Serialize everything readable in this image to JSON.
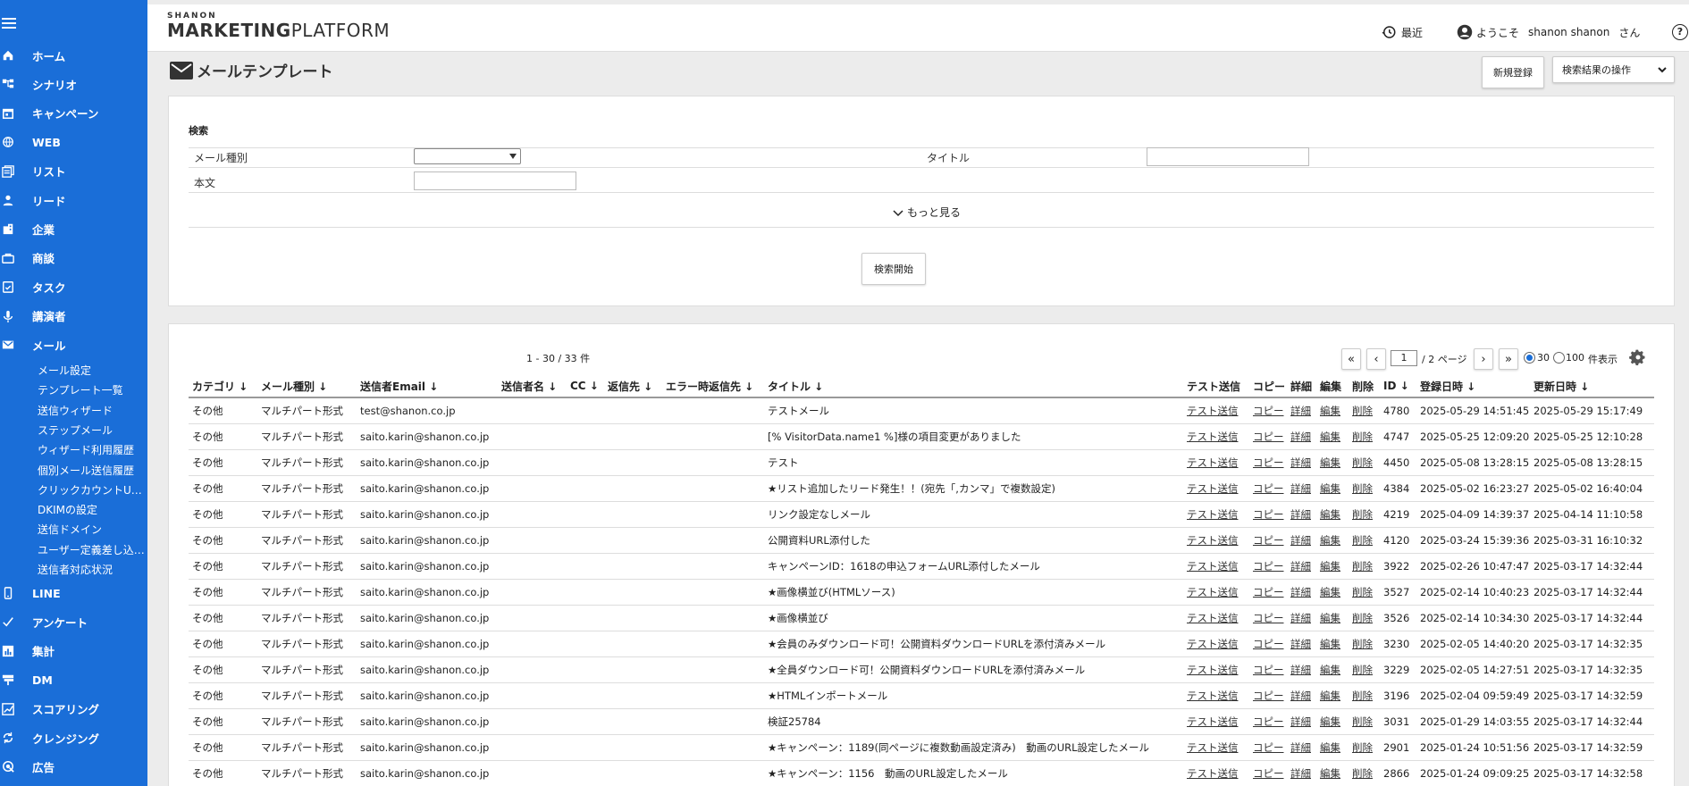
{
  "brand": {
    "small": "SHANON",
    "main_bold": "MARKETING",
    "main_rest": "PLATFORM"
  },
  "header": {
    "recent": "最近",
    "welcome": "ようこそ",
    "user": "shanon shanon",
    "suffix": "さん",
    "help": "?"
  },
  "nav": [
    {
      "key": "home",
      "label": "ホーム",
      "icon": "home-icon"
    },
    {
      "key": "scenario",
      "label": "シナリオ",
      "icon": "flow-icon"
    },
    {
      "key": "campaign",
      "label": "キャンペーン",
      "icon": "calendar-icon"
    },
    {
      "key": "web",
      "label": "WEB",
      "icon": "globe-icon"
    },
    {
      "key": "list",
      "label": "リスト",
      "icon": "list-icon"
    },
    {
      "key": "lead",
      "label": "リード",
      "icon": "person-icon"
    },
    {
      "key": "company",
      "label": "企業",
      "icon": "building-icon"
    },
    {
      "key": "deal",
      "label": "商談",
      "icon": "briefcase-icon"
    },
    {
      "key": "task",
      "label": "タスク",
      "icon": "task-icon"
    },
    {
      "key": "speaker",
      "label": "講演者",
      "icon": "mic-icon"
    },
    {
      "key": "mail",
      "label": "メール",
      "icon": "mail-icon"
    }
  ],
  "mail_sub": [
    "メール設定",
    "テンプレート一覧",
    "送信ウィザード",
    "ステップメール",
    "ウィザード利用履歴",
    "個別メール送信履歴",
    "クリックカウントU…",
    "DKIMの設定",
    "送信ドメイン",
    "ユーザー定義差し込…",
    "送信者対応状況"
  ],
  "nav_bottom": [
    {
      "key": "line",
      "label": "LINE",
      "icon": "phone-icon"
    },
    {
      "key": "survey",
      "label": "アンケート",
      "icon": "check-icon"
    },
    {
      "key": "report",
      "label": "集計",
      "icon": "chart-icon"
    },
    {
      "key": "dm",
      "label": "DM",
      "icon": "signpost-icon"
    },
    {
      "key": "scoring",
      "label": "スコアリング",
      "icon": "score-icon"
    },
    {
      "key": "cleansing",
      "label": "クレンジング",
      "icon": "cleanse-icon"
    },
    {
      "key": "ads",
      "label": "広告",
      "icon": "ads-icon"
    }
  ],
  "page": {
    "title": "メールテンプレート",
    "new_button": "新規登録",
    "ops_select": "検索結果の操作"
  },
  "search": {
    "heading": "検索",
    "mail_type_label": "メール種別",
    "title_label": "タイトル",
    "body_label": "本文",
    "more": "もっと見る",
    "submit": "検索開始"
  },
  "results": {
    "count": "1 - 30 / 33 件",
    "pager": {
      "first": "«",
      "prev": "‹",
      "page": "1",
      "pages": "/ 2 ページ",
      "next": "›",
      "last": "»"
    },
    "per_page": {
      "opt30": "30",
      "opt100": "100",
      "suffix": "件表示",
      "selected": 30
    },
    "columns": [
      "カテゴリ ↓",
      "メール種別 ↓",
      "送信者Email ↓",
      "送信者名 ↓",
      "CC ↓",
      "返信先 ↓",
      "エラー時返信先 ↓",
      "タイトル ↓",
      "テスト送信",
      "コピー",
      "詳細",
      "編集",
      "削除",
      "ID ↓",
      "登録日時 ↓",
      "更新日時 ↓"
    ],
    "action_labels": {
      "test": "テスト送信",
      "copy": "コピー",
      "detail": "詳細",
      "edit": "編集",
      "delete": "削除"
    },
    "rows": [
      {
        "category": "その他",
        "type": "マルチパート形式",
        "email": "test@shanon.co.jp",
        "title": "テストメール",
        "id": "4780",
        "created": "2025-05-29 14:51:45",
        "updated": "2025-05-29 15:17:49"
      },
      {
        "category": "その他",
        "type": "マルチパート形式",
        "email": "saito.karin@shanon.co.jp",
        "title": "[% VisitorData.name1 %]様の項目変更がありました",
        "id": "4747",
        "created": "2025-05-25 12:09:20",
        "updated": "2025-05-25 12:10:28"
      },
      {
        "category": "その他",
        "type": "マルチパート形式",
        "email": "saito.karin@shanon.co.jp",
        "title": "テスト",
        "id": "4450",
        "created": "2025-05-08 13:28:15",
        "updated": "2025-05-08 13:28:15"
      },
      {
        "category": "その他",
        "type": "マルチパート形式",
        "email": "saito.karin@shanon.co.jp",
        "title": "★リスト追加したリード発生！！(宛先「,カンマ」で複数設定)",
        "id": "4384",
        "created": "2025-05-02 16:23:27",
        "updated": "2025-05-02 16:40:04"
      },
      {
        "category": "その他",
        "type": "マルチパート形式",
        "email": "saito.karin@shanon.co.jp",
        "title": "リンク設定なしメール",
        "id": "4219",
        "created": "2025-04-09 14:39:37",
        "updated": "2025-04-14 11:10:58"
      },
      {
        "category": "その他",
        "type": "マルチパート形式",
        "email": "saito.karin@shanon.co.jp",
        "title": "公開資料URL添付した",
        "id": "4120",
        "created": "2025-03-24 15:39:36",
        "updated": "2025-03-31 16:10:32"
      },
      {
        "category": "その他",
        "type": "マルチパート形式",
        "email": "saito.karin@shanon.co.jp",
        "title": "キャンペーンID：1618の申込フォームURL添付したメール",
        "id": "3922",
        "created": "2025-02-26 10:47:47",
        "updated": "2025-03-17 14:32:44"
      },
      {
        "category": "その他",
        "type": "マルチパート形式",
        "email": "saito.karin@shanon.co.jp",
        "title": "★画像横並び(HTMLソース)",
        "id": "3527",
        "created": "2025-02-14 10:40:23",
        "updated": "2025-03-17 14:32:44"
      },
      {
        "category": "その他",
        "type": "マルチパート形式",
        "email": "saito.karin@shanon.co.jp",
        "title": "★画像横並び",
        "id": "3526",
        "created": "2025-02-14 10:34:30",
        "updated": "2025-03-17 14:32:44"
      },
      {
        "category": "その他",
        "type": "マルチパート形式",
        "email": "saito.karin@shanon.co.jp",
        "title": "★会員のみダウンロード可！公開資料ダウンロードURLを添付済みメール",
        "id": "3230",
        "created": "2025-02-05 14:40:20",
        "updated": "2025-03-17 14:32:35"
      },
      {
        "category": "その他",
        "type": "マルチパート形式",
        "email": "saito.karin@shanon.co.jp",
        "title": "★全員ダウンロード可！公開資料ダウンロードURLを添付済みメール",
        "id": "3229",
        "created": "2025-02-05 14:27:51",
        "updated": "2025-03-17 14:32:35"
      },
      {
        "category": "その他",
        "type": "マルチパート形式",
        "email": "saito.karin@shanon.co.jp",
        "title": "★HTMLインポートメール",
        "id": "3196",
        "created": "2025-02-04 09:59:49",
        "updated": "2025-03-17 14:32:59"
      },
      {
        "category": "その他",
        "type": "マルチパート形式",
        "email": "saito.karin@shanon.co.jp",
        "title": "検証25784",
        "id": "3031",
        "created": "2025-01-29 14:03:55",
        "updated": "2025-03-17 14:32:44"
      },
      {
        "category": "その他",
        "type": "マルチパート形式",
        "email": "saito.karin@shanon.co.jp",
        "title": "★キャンペーン：1189(同ページに複数動画設定済み)　動画のURL設定したメール",
        "id": "2901",
        "created": "2025-01-24 10:51:56",
        "updated": "2025-03-17 14:32:59"
      },
      {
        "category": "その他",
        "type": "マルチパート形式",
        "email": "saito.karin@shanon.co.jp",
        "title": "★キャンペーン：1156　動画のURL設定したメール",
        "id": "2866",
        "created": "2025-01-24 09:09:25",
        "updated": "2025-03-17 14:32:58"
      }
    ]
  }
}
